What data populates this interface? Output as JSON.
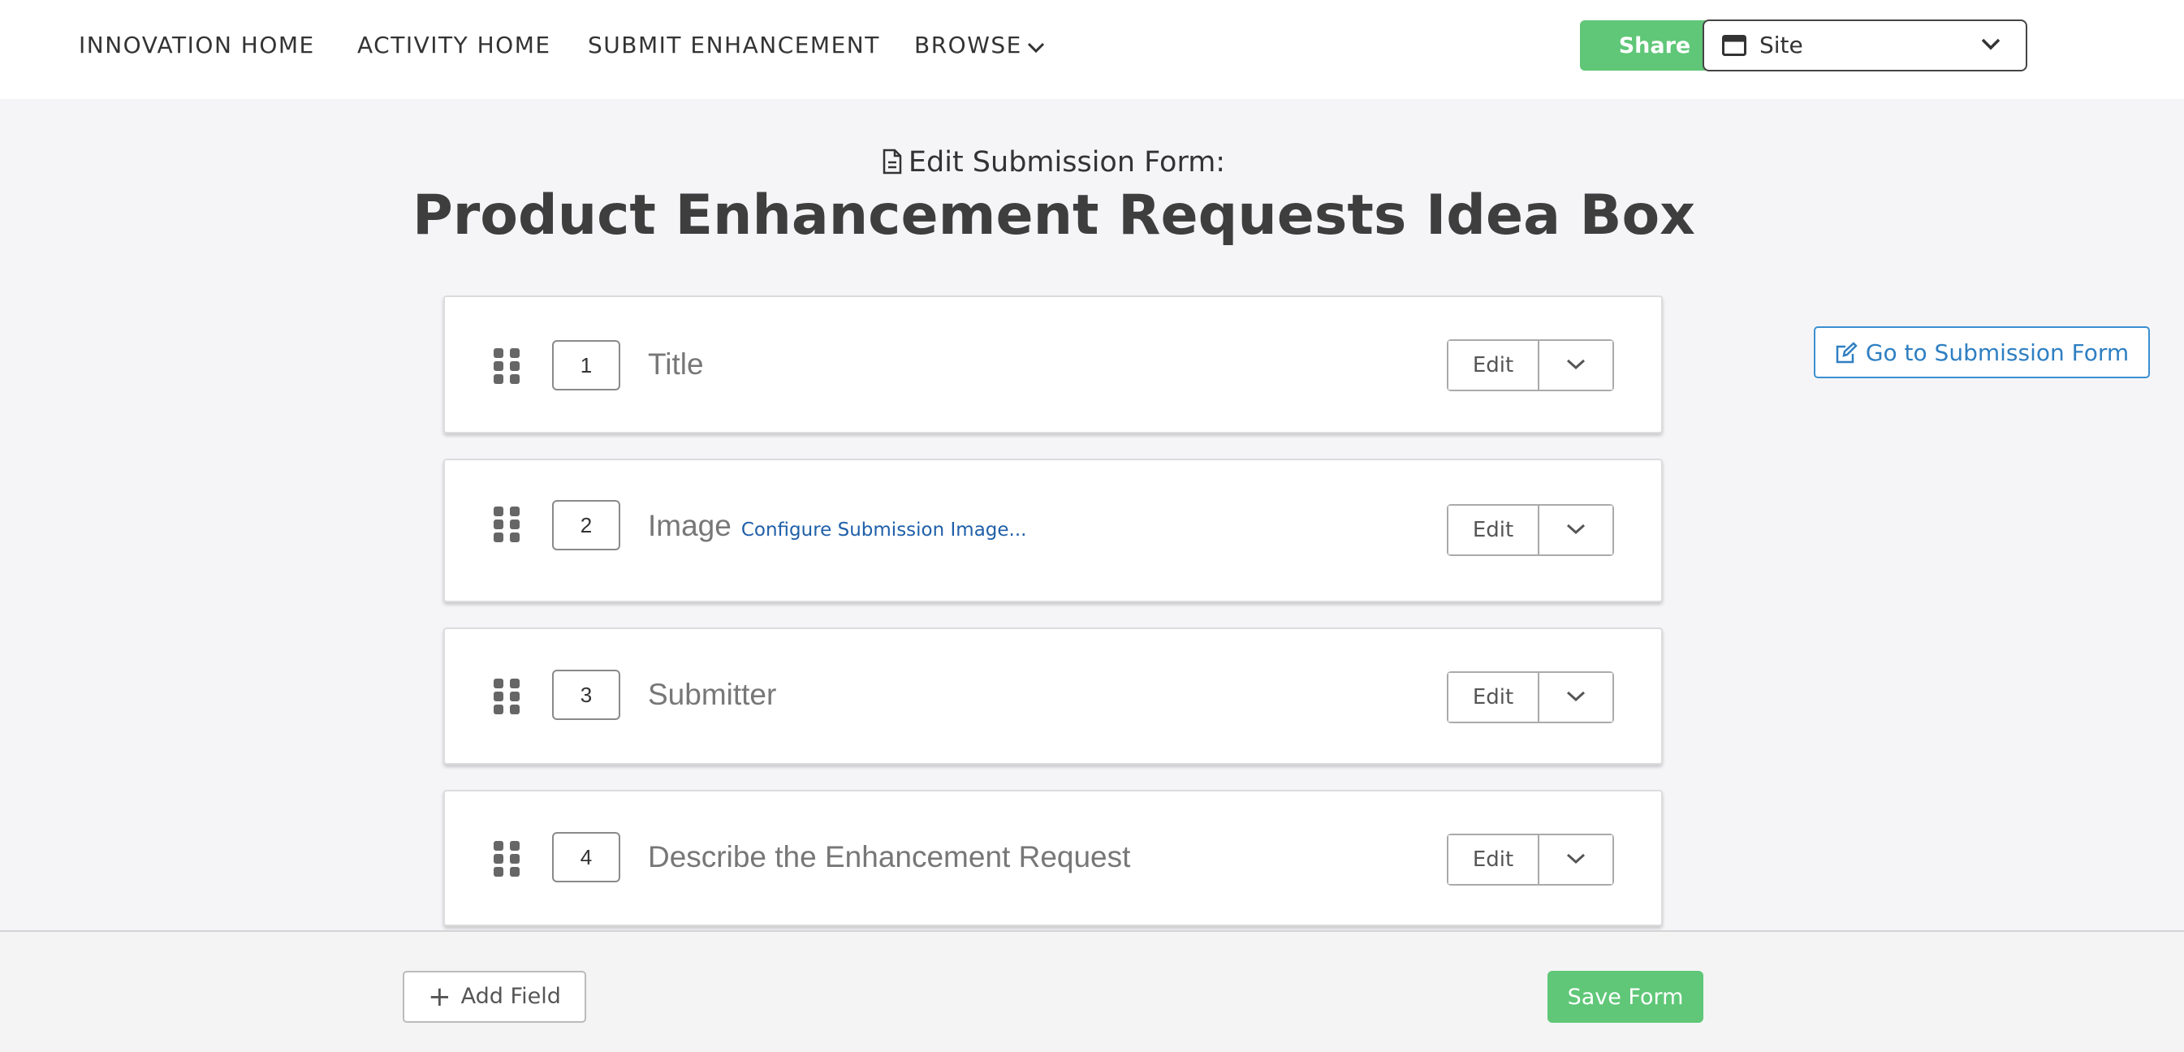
{
  "nav": {
    "items": [
      "INNOVATION HOME",
      "ACTIVITY HOME",
      "SUBMIT ENHANCEMENT",
      "BROWSE"
    ],
    "share_label": "Share",
    "site_select_value": "Site"
  },
  "header": {
    "subheading": "Edit Submission Form:",
    "title": "Product Enhancement Requests Idea Box"
  },
  "goto_form_label": "Go to Submission Form",
  "fields": [
    {
      "number": "1",
      "label": "Title",
      "edit_label": "Edit"
    },
    {
      "number": "2",
      "label": "Image",
      "link": "Configure Submission Image...",
      "edit_label": "Edit"
    },
    {
      "number": "3",
      "label": "Submitter",
      "edit_label": "Edit"
    },
    {
      "number": "4",
      "label": "Describe the Enhancement Request",
      "edit_label": "Edit"
    }
  ],
  "footer": {
    "add_field_label": "Add Field",
    "save_label": "Save Form"
  },
  "colors": {
    "accent_green": "#5fc777",
    "link_blue": "#2f7fc2",
    "background": "#f5f5f8"
  },
  "icons": {
    "browse": "chevron-down-icon",
    "site": "window-icon",
    "subheading": "document-icon",
    "goto": "edit-external-icon",
    "drag": "drag-handle-icon",
    "add": "plus-icon"
  }
}
